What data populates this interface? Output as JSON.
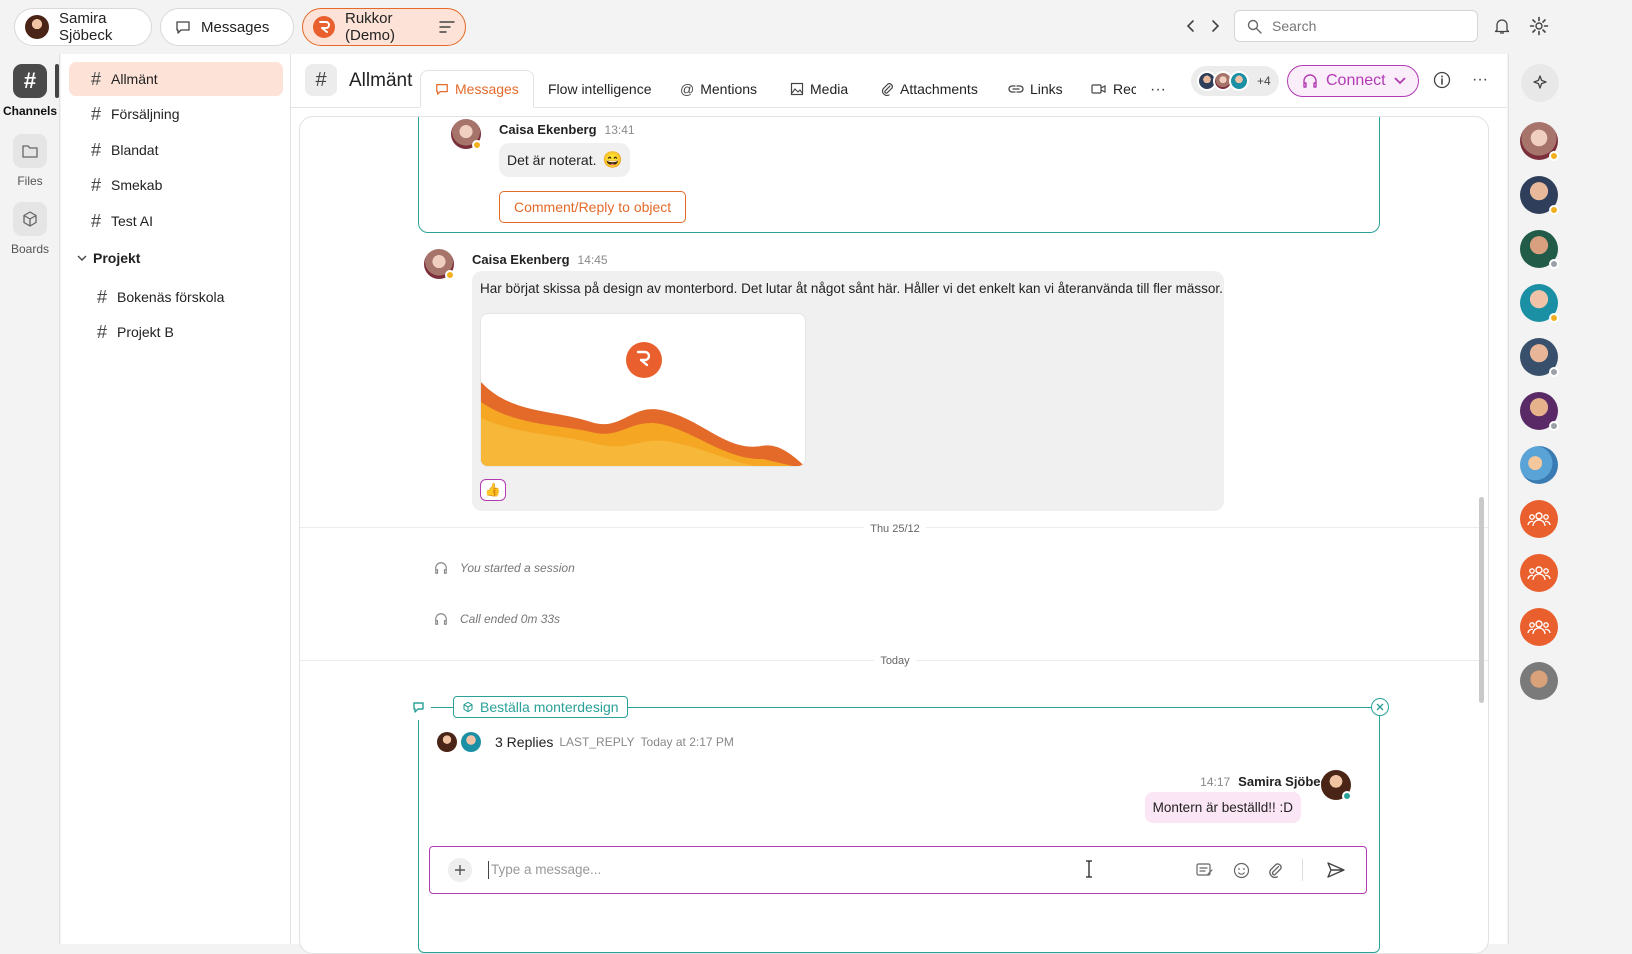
{
  "topbar": {
    "user_name": "Samira Sjöbeck",
    "messages_label": "Messages",
    "workspace_name": "Rukkor (Demo)",
    "search_placeholder": "Search"
  },
  "left_rail": {
    "items": [
      {
        "label": "Channels"
      },
      {
        "label": "Files"
      },
      {
        "label": "Boards"
      }
    ]
  },
  "sidebar": {
    "channels": [
      "Allmänt",
      "Försäljning",
      "Blandat",
      "Smekab",
      "Test AI"
    ],
    "group_title": "Projekt",
    "group_channels": [
      "Bokenäs förskola",
      "Projekt B"
    ]
  },
  "channel_header": {
    "title": "Allmänt",
    "tabs": [
      "Messages",
      "Flow intelligence",
      "Mentions",
      "Media",
      "Attachments",
      "Links",
      "Reco"
    ],
    "member_extra": "+4",
    "connect_label": "Connect"
  },
  "feed": {
    "msg1": {
      "author": "Caisa Ekenberg",
      "time": "13:41",
      "text": "Det är noterat.",
      "emoji": "😄",
      "action_label": "Comment/Reply to object"
    },
    "msg2": {
      "author": "Caisa Ekenberg",
      "time": "14:45",
      "text": "Har börjat skissa på design av monterbord. Det lutar åt något sånt här. Håller vi det enkelt kan vi återanvända till fler mässor.",
      "reaction": "👍"
    },
    "day1": "Thu 25/12",
    "sys1": "You started a session",
    "sys2": "Call ended 0m 33s",
    "day2": "Today",
    "thread": {
      "tag": "Beställa monterdesign",
      "replies": "3 Replies",
      "last_reply_key": "LAST_REPLY",
      "last_reply_time": "Today at 2:17 PM",
      "reply_time": "14:17",
      "reply_author": "Samira Sjöbeck",
      "reply_text": "Montern är beställd!! :D",
      "input_placeholder": "Type a message..."
    }
  },
  "colors": {
    "accent_orange": "#e46a2a",
    "thread_teal": "#2aa198",
    "connect_purple": "#b23bb3"
  }
}
